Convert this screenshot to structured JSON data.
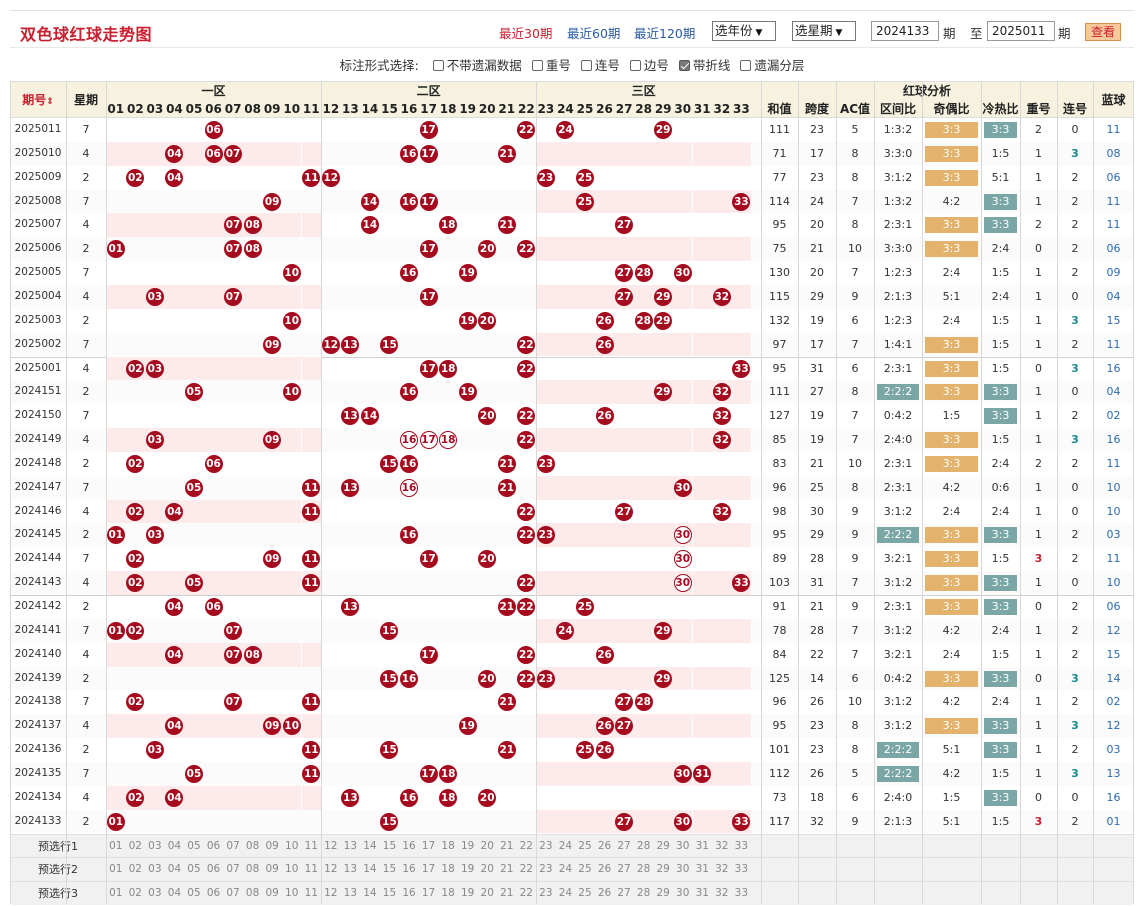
{
  "header": {
    "title": "双色球红球走势图",
    "links": [
      "最近30期",
      "最近60期",
      "最近120期"
    ],
    "year_select": "选年份",
    "week_select": "选星期",
    "from_issue": "2024133",
    "period1": "期",
    "to_label": "至",
    "to_issue": "2025011",
    "period2": "期",
    "query": "查看"
  },
  "options": {
    "label": "标注形式选择:",
    "items": [
      {
        "label": "不带遗漏数据",
        "checked": false
      },
      {
        "label": "重号",
        "checked": false
      },
      {
        "label": "连号",
        "checked": false
      },
      {
        "label": "边号",
        "checked": false
      },
      {
        "label": "带折线",
        "checked": true
      },
      {
        "label": "遗漏分层",
        "checked": false
      }
    ]
  },
  "columns": {
    "issue": "期号",
    "week": "星期",
    "zone1": "一区",
    "zone2": "二区",
    "zone3": "三区",
    "analysis": "红球分析",
    "blue": "蓝球",
    "sum": "和值",
    "span": "跨度",
    "ac": "AC值",
    "zone_ratio": "区间比",
    "odd_even": "奇偶比",
    "hot_cold": "冷热比",
    "repeat": "重号",
    "consecutive": "连号",
    "numbers": [
      "01",
      "02",
      "03",
      "04",
      "05",
      "06",
      "07",
      "08",
      "09",
      "10",
      "11",
      "12",
      "13",
      "14",
      "15",
      "16",
      "17",
      "18",
      "19",
      "20",
      "21",
      "22",
      "23",
      "24",
      "25",
      "26",
      "27",
      "28",
      "29",
      "30",
      "31",
      "32",
      "33"
    ]
  },
  "colors": {
    "ball": "#a50a1e",
    "odd_even_bg": "#e3b26c",
    "hot_cold_bg": "#7aa7a5",
    "zone_bg": "#7aa7a5",
    "blue_text": "#2a6cb6",
    "accent": "#c8202f"
  },
  "rows": [
    {
      "issue": "2025011",
      "week": "7",
      "balls": [
        6,
        17,
        22,
        24,
        29
      ],
      "sum": "111",
      "span": "23",
      "ac": "5",
      "zr": "1:3:2",
      "oe": "3:3",
      "oe_hl": true,
      "hc": "3:3",
      "hc_hl": true,
      "rep": "2",
      "con": "0",
      "blue": "11"
    },
    {
      "issue": "2025010",
      "week": "4",
      "balls": [
        4,
        6,
        7,
        16,
        17,
        21
      ],
      "sum": "71",
      "span": "17",
      "ac": "8",
      "zr": "3:3:0",
      "oe": "3:3",
      "oe_hl": true,
      "hc": "1:5",
      "hc_hl": false,
      "rep": "1",
      "con": "3",
      "blue": "08"
    },
    {
      "issue": "2025009",
      "week": "2",
      "balls": [
        2,
        4,
        11,
        12,
        23,
        25
      ],
      "sum": "77",
      "span": "23",
      "ac": "8",
      "zr": "3:1:2",
      "oe": "3:3",
      "oe_hl": true,
      "hc": "5:1",
      "hc_hl": false,
      "rep": "1",
      "con": "2",
      "blue": "06"
    },
    {
      "issue": "2025008",
      "week": "7",
      "balls": [
        9,
        14,
        16,
        17,
        25,
        33
      ],
      "sum": "114",
      "span": "24",
      "ac": "7",
      "zr": "1:3:2",
      "oe": "4:2",
      "oe_hl": false,
      "hc": "3:3",
      "hc_hl": true,
      "rep": "1",
      "con": "2",
      "blue": "11"
    },
    {
      "issue": "2025007",
      "week": "4",
      "balls": [
        7,
        8,
        14,
        18,
        21,
        27
      ],
      "sum": "95",
      "span": "20",
      "ac": "8",
      "zr": "2:3:1",
      "oe": "3:3",
      "oe_hl": true,
      "hc": "3:3",
      "hc_hl": true,
      "rep": "2",
      "con": "2",
      "blue": "11"
    },
    {
      "issue": "2025006",
      "week": "2",
      "balls": [
        1,
        7,
        8,
        17,
        20,
        22
      ],
      "sum": "75",
      "span": "21",
      "ac": "10",
      "zr": "3:3:0",
      "oe": "3:3",
      "oe_hl": true,
      "hc": "2:4",
      "hc_hl": false,
      "rep": "0",
      "con": "2",
      "blue": "06"
    },
    {
      "issue": "2025005",
      "week": "7",
      "balls": [
        10,
        16,
        19,
        27,
        28,
        30
      ],
      "sum": "130",
      "span": "20",
      "ac": "7",
      "zr": "1:2:3",
      "oe": "2:4",
      "oe_hl": false,
      "hc": "1:5",
      "hc_hl": false,
      "rep": "1",
      "con": "2",
      "blue": "09"
    },
    {
      "issue": "2025004",
      "week": "4",
      "balls": [
        3,
        7,
        17,
        27,
        29,
        32
      ],
      "sum": "115",
      "span": "29",
      "ac": "9",
      "zr": "2:1:3",
      "oe": "5:1",
      "oe_hl": false,
      "hc": "2:4",
      "hc_hl": false,
      "rep": "1",
      "con": "0",
      "blue": "04"
    },
    {
      "issue": "2025003",
      "week": "2",
      "balls": [
        10,
        19,
        20,
        26,
        28,
        29
      ],
      "sum": "132",
      "span": "19",
      "ac": "6",
      "zr": "1:2:3",
      "oe": "2:4",
      "oe_hl": false,
      "hc": "1:5",
      "hc_hl": false,
      "rep": "1",
      "con": "3",
      "blue": "15"
    },
    {
      "issue": "2025002",
      "week": "7",
      "balls": [
        9,
        12,
        13,
        15,
        22,
        26
      ],
      "sum": "97",
      "span": "17",
      "ac": "7",
      "zr": "1:4:1",
      "oe": "3:3",
      "oe_hl": true,
      "hc": "1:5",
      "hc_hl": false,
      "rep": "1",
      "con": "2",
      "blue": "11"
    },
    {
      "issue": "2025001",
      "week": "4",
      "balls": [
        2,
        3,
        17,
        18,
        22,
        33
      ],
      "sum": "95",
      "span": "31",
      "ac": "6",
      "zr": "2:3:1",
      "oe": "3:3",
      "oe_hl": true,
      "hc": "1:5",
      "hc_hl": false,
      "rep": "0",
      "con": "3",
      "blue": "16"
    },
    {
      "issue": "2024151",
      "week": "2",
      "balls": [
        5,
        10,
        16,
        19,
        29,
        32
      ],
      "sum": "111",
      "span": "27",
      "ac": "8",
      "zr": "2:2:2",
      "zr_hl": true,
      "oe": "3:3",
      "oe_hl": true,
      "hc": "3:3",
      "hc_hl": true,
      "rep": "1",
      "con": "0",
      "blue": "04"
    },
    {
      "issue": "2024150",
      "week": "7",
      "balls": [
        13,
        14,
        20,
        22,
        26,
        32
      ],
      "sum": "127",
      "span": "19",
      "ac": "7",
      "zr": "0:4:2",
      "oe": "1:5",
      "oe_hl": false,
      "hc": "3:3",
      "hc_hl": true,
      "rep": "1",
      "con": "2",
      "blue": "02"
    },
    {
      "issue": "2024149",
      "week": "4",
      "balls": [
        3,
        9,
        22,
        32
      ],
      "hollow": [
        16,
        17,
        18
      ],
      "sum": "85",
      "span": "19",
      "ac": "7",
      "zr": "2:4:0",
      "oe": "3:3",
      "oe_hl": true,
      "hc": "1:5",
      "hc_hl": false,
      "rep": "1",
      "con": "3",
      "blue": "16"
    },
    {
      "issue": "2024148",
      "week": "2",
      "balls": [
        2,
        6,
        15,
        16,
        21,
        23
      ],
      "sum": "83",
      "span": "21",
      "ac": "10",
      "zr": "2:3:1",
      "oe": "3:3",
      "oe_hl": true,
      "hc": "2:4",
      "hc_hl": false,
      "rep": "2",
      "con": "2",
      "blue": "11"
    },
    {
      "issue": "2024147",
      "week": "7",
      "balls": [
        5,
        11,
        13,
        21,
        30
      ],
      "hollow": [
        16
      ],
      "sum": "96",
      "span": "25",
      "ac": "8",
      "zr": "2:3:1",
      "oe": "4:2",
      "oe_hl": false,
      "hc": "0:6",
      "hc_hl": false,
      "rep": "1",
      "con": "0",
      "blue": "10"
    },
    {
      "issue": "2024146",
      "week": "4",
      "balls": [
        2,
        4,
        11,
        22,
        27,
        32
      ],
      "sum": "98",
      "span": "30",
      "ac": "9",
      "zr": "3:1:2",
      "oe": "2:4",
      "oe_hl": false,
      "hc": "2:4",
      "hc_hl": false,
      "rep": "1",
      "con": "0",
      "blue": "10"
    },
    {
      "issue": "2024145",
      "week": "2",
      "balls": [
        1,
        3,
        16,
        22,
        23
      ],
      "hollow": [
        30
      ],
      "sum": "95",
      "span": "29",
      "ac": "9",
      "zr": "2:2:2",
      "zr_hl": true,
      "oe": "3:3",
      "oe_hl": true,
      "hc": "3:3",
      "hc_hl": true,
      "rep": "1",
      "con": "2",
      "blue": "03"
    },
    {
      "issue": "2024144",
      "week": "7",
      "balls": [
        2,
        9,
        11,
        17,
        20
      ],
      "hollow": [
        30
      ],
      "sum": "89",
      "span": "28",
      "ac": "9",
      "zr": "3:2:1",
      "oe": "3:3",
      "oe_hl": true,
      "hc": "1:5",
      "hc_hl": false,
      "rep": "3",
      "con": "2",
      "blue": "11"
    },
    {
      "issue": "2024143",
      "week": "4",
      "balls": [
        2,
        5,
        11,
        22,
        33
      ],
      "hollow": [
        30
      ],
      "sum": "103",
      "span": "31",
      "ac": "7",
      "zr": "3:1:2",
      "oe": "3:3",
      "oe_hl": true,
      "hc": "3:3",
      "hc_hl": true,
      "rep": "1",
      "con": "0",
      "blue": "10"
    },
    {
      "issue": "2024142",
      "week": "2",
      "balls": [
        4,
        6,
        13,
        21,
        22,
        25
      ],
      "sum": "91",
      "span": "21",
      "ac": "9",
      "zr": "2:3:1",
      "oe": "3:3",
      "oe_hl": true,
      "hc": "3:3",
      "hc_hl": true,
      "rep": "0",
      "con": "2",
      "blue": "06"
    },
    {
      "issue": "2024141",
      "week": "7",
      "balls": [
        1,
        2,
        7,
        15,
        24,
        29
      ],
      "sum": "78",
      "span": "28",
      "ac": "7",
      "zr": "3:1:2",
      "oe": "4:2",
      "oe_hl": false,
      "hc": "2:4",
      "hc_hl": false,
      "rep": "1",
      "con": "2",
      "blue": "12"
    },
    {
      "issue": "2024140",
      "week": "4",
      "balls": [
        4,
        7,
        8,
        17,
        22,
        26
      ],
      "sum": "84",
      "span": "22",
      "ac": "7",
      "zr": "3:2:1",
      "oe": "2:4",
      "oe_hl": false,
      "hc": "1:5",
      "hc_hl": false,
      "rep": "1",
      "con": "2",
      "blue": "15"
    },
    {
      "issue": "2024139",
      "week": "2",
      "balls": [
        15,
        16,
        20,
        22,
        23,
        29
      ],
      "sum": "125",
      "span": "14",
      "ac": "6",
      "zr": "0:4:2",
      "oe": "3:3",
      "oe_hl": true,
      "hc": "3:3",
      "hc_hl": true,
      "rep": "0",
      "con": "3",
      "blue": "14"
    },
    {
      "issue": "2024138",
      "week": "7",
      "balls": [
        2,
        7,
        11,
        21,
        27,
        28
      ],
      "sum": "96",
      "span": "26",
      "ac": "10",
      "zr": "3:1:2",
      "oe": "4:2",
      "oe_hl": false,
      "hc": "2:4",
      "hc_hl": false,
      "rep": "1",
      "con": "2",
      "blue": "02"
    },
    {
      "issue": "2024137",
      "week": "4",
      "balls": [
        4,
        9,
        10,
        19,
        26,
        27
      ],
      "sum": "95",
      "span": "23",
      "ac": "8",
      "zr": "3:1:2",
      "oe": "3:3",
      "oe_hl": true,
      "hc": "3:3",
      "hc_hl": true,
      "rep": "1",
      "con": "3",
      "blue": "12"
    },
    {
      "issue": "2024136",
      "week": "2",
      "balls": [
        3,
        11,
        15,
        21,
        25,
        26
      ],
      "sum": "101",
      "span": "23",
      "ac": "8",
      "zr": "2:2:2",
      "zr_hl": true,
      "oe": "5:1",
      "oe_hl": false,
      "hc": "3:3",
      "hc_hl": true,
      "rep": "1",
      "con": "2",
      "blue": "03"
    },
    {
      "issue": "2024135",
      "week": "7",
      "balls": [
        5,
        11,
        17,
        18,
        30,
        31
      ],
      "sum": "112",
      "span": "26",
      "ac": "5",
      "zr": "2:2:2",
      "zr_hl": true,
      "oe": "4:2",
      "oe_hl": false,
      "hc": "1:5",
      "hc_hl": false,
      "rep": "1",
      "con": "3",
      "blue": "13"
    },
    {
      "issue": "2024134",
      "week": "4",
      "balls": [
        2,
        4,
        13,
        16,
        18,
        20
      ],
      "sum": "73",
      "span": "18",
      "ac": "6",
      "zr": "2:4:0",
      "oe": "1:5",
      "oe_hl": false,
      "hc": "3:3",
      "hc_hl": true,
      "rep": "0",
      "con": "0",
      "blue": "16"
    },
    {
      "issue": "2024133",
      "week": "2",
      "balls": [
        1,
        15,
        27,
        30,
        33
      ],
      "sum": "117",
      "span": "32",
      "ac": "9",
      "zr": "2:1:3",
      "oe": "5:1",
      "oe_hl": false,
      "hc": "1:5",
      "hc_hl": false,
      "rep": "3",
      "con": "2",
      "blue": "01"
    }
  ],
  "presets": [
    "预选行1",
    "预选行2",
    "预选行3"
  ]
}
